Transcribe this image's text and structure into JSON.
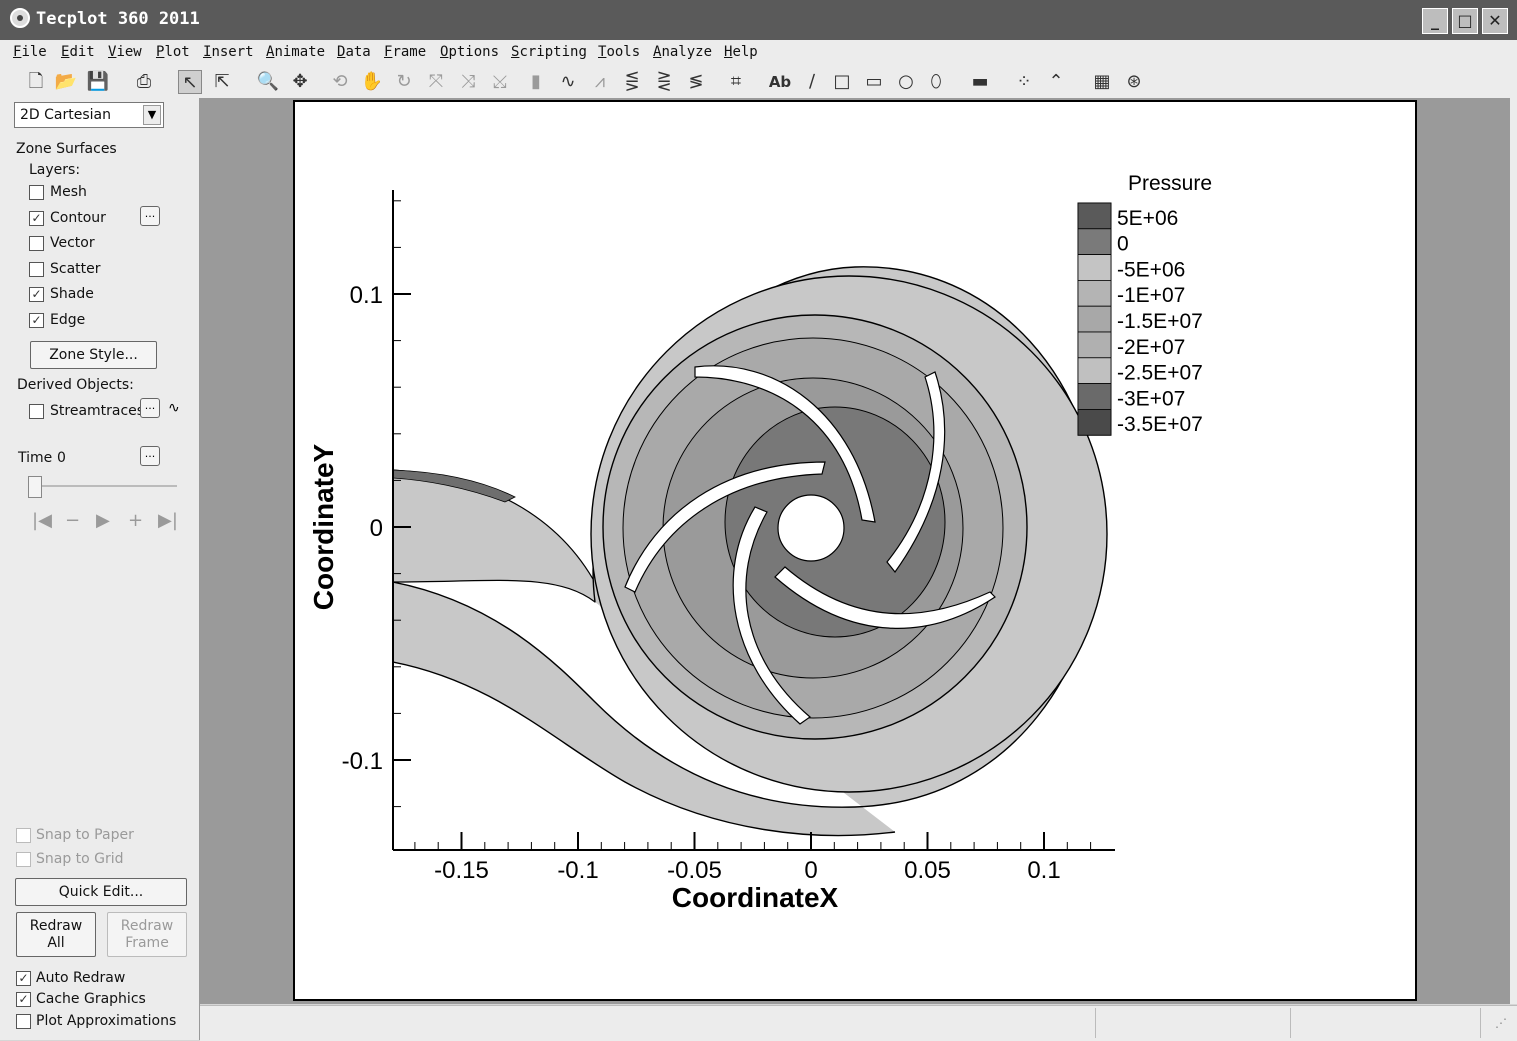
{
  "window": {
    "title": "Tecplot 360 2011"
  },
  "menu": [
    "File",
    "Edit",
    "View",
    "Plot",
    "Insert",
    "Animate",
    "Data",
    "Frame",
    "Options",
    "Scripting",
    "Tools",
    "Analyze",
    "Help"
  ],
  "sidebar": {
    "plot_type": "2D Cartesian",
    "zone_surfaces": "Zone Surfaces",
    "layers": "Layers:",
    "layer_items": [
      {
        "label": "Mesh",
        "checked": false
      },
      {
        "label": "Contour",
        "checked": true
      },
      {
        "label": "Vector",
        "checked": false
      },
      {
        "label": "Scatter",
        "checked": false
      },
      {
        "label": "Shade",
        "checked": true
      },
      {
        "label": "Edge",
        "checked": true
      }
    ],
    "zone_style_button": "Zone Style...",
    "derived_objects": "Derived Objects:",
    "streamtraces": "Streamtraces",
    "time_label": "Time",
    "time_value": "0",
    "more_button": "...",
    "snap_to_paper": "Snap to Paper",
    "snap_to_grid": "Snap to Grid",
    "quick_edit": "Quick Edit...",
    "redraw_all_1": "Redraw",
    "redraw_all_2": "All",
    "redraw_frame_1": "Redraw",
    "redraw_frame_2": "Frame",
    "auto_redraw": "Auto Redraw",
    "cache_graphics": "Cache Graphics",
    "plot_approximations": "Plot Approximations"
  },
  "plot": {
    "xlabel": "CoordinateX",
    "ylabel": "CoordinateY",
    "xticks": [
      "-0.15",
      "-0.1",
      "-0.05",
      "0",
      "0.05",
      "0.1"
    ],
    "yticks": [
      "0.1",
      "0",
      "-0.1"
    ],
    "legend_title": "Pressure",
    "legend_levels": [
      "5E+06",
      "0",
      "-5E+06",
      "-1E+07",
      "-1.5E+07",
      "-2E+07",
      "-2.5E+07",
      "-3E+07",
      "-3.5E+07"
    ]
  },
  "colors": {
    "titlebar": "#5a5a5a",
    "panel": "#ececec",
    "workarea": "#9a9a9a"
  }
}
